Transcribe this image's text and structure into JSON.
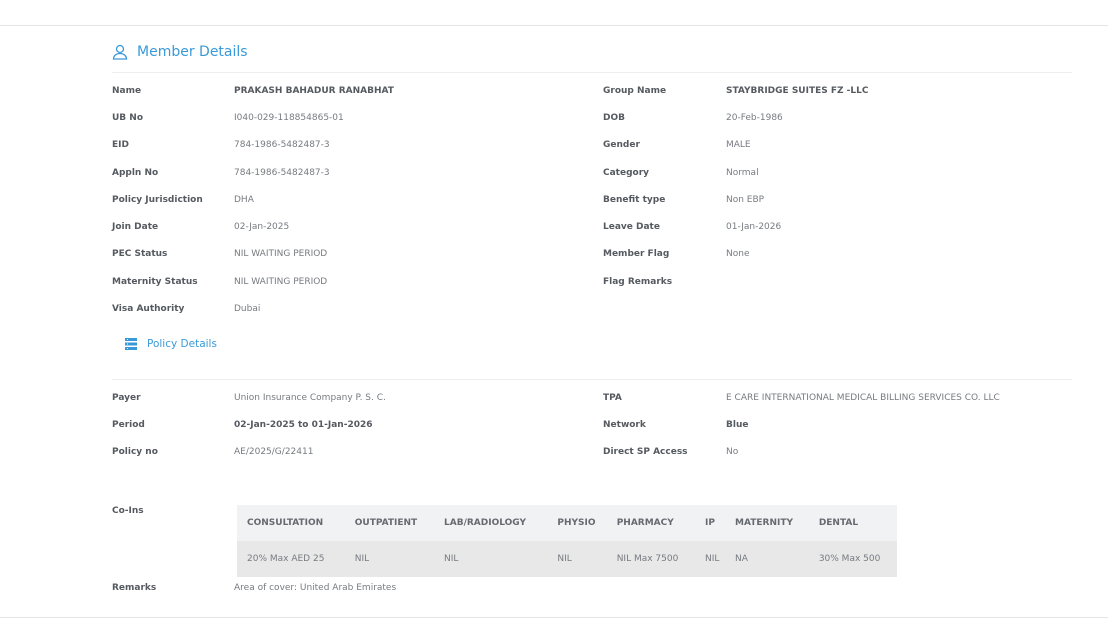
{
  "member": {
    "title": "Member Details",
    "rows": [
      [
        "Name",
        "PRAKASH BAHADUR RANABHAT",
        "Group Name",
        "STAYBRIDGE SUITES FZ -LLC"
      ],
      [
        "UB No",
        "I040-029-118854865-01",
        "DOB",
        "20-Feb-1986"
      ],
      [
        "EID",
        "784-1986-5482487-3",
        "Gender",
        "MALE"
      ],
      [
        "Appln No",
        "784-1986-5482487-3",
        "Category",
        "Normal"
      ],
      [
        "Policy Jurisdiction",
        "DHA",
        "Benefit type",
        "Non EBP"
      ],
      [
        "Join Date",
        "02-Jan-2025",
        "Leave Date",
        "01-Jan-2026"
      ],
      [
        "PEC Status",
        "NIL WAITING PERIOD",
        "Member Flag",
        "None"
      ],
      [
        "Maternity Status",
        "NIL WAITING PERIOD",
        "Flag Remarks",
        ""
      ],
      [
        "Visa Authority",
        "Dubai",
        "",
        ""
      ]
    ]
  },
  "policy": {
    "title": "Policy Details",
    "rows": [
      [
        "Payer",
        "Union Insurance Company P. S. C.",
        "TPA",
        "E CARE INTERNATIONAL MEDICAL BILLING SERVICES CO. LLC"
      ],
      [
        "Period",
        "02-Jan-2025 to 01-Jan-2026",
        "Network",
        "Blue"
      ],
      [
        "Policy no",
        "AE/2025/G/22411",
        "Direct SP Access",
        "No"
      ]
    ]
  },
  "coins": {
    "label": "Co-Ins",
    "headers": [
      "CONSULTATION",
      "OUTPATIENT",
      "LAB/RADIOLOGY",
      "PHYSIO",
      "PHARMACY",
      "IP",
      "MATERNITY",
      "DENTAL"
    ],
    "values": [
      "20% Max AED 25",
      "NIL",
      "NIL",
      "NIL",
      "NIL Max 7500",
      "NIL",
      "NA",
      "30% Max 500"
    ]
  },
  "remarks": {
    "label": "Remarks",
    "value": "Area of cover: United Arab Emirates"
  }
}
